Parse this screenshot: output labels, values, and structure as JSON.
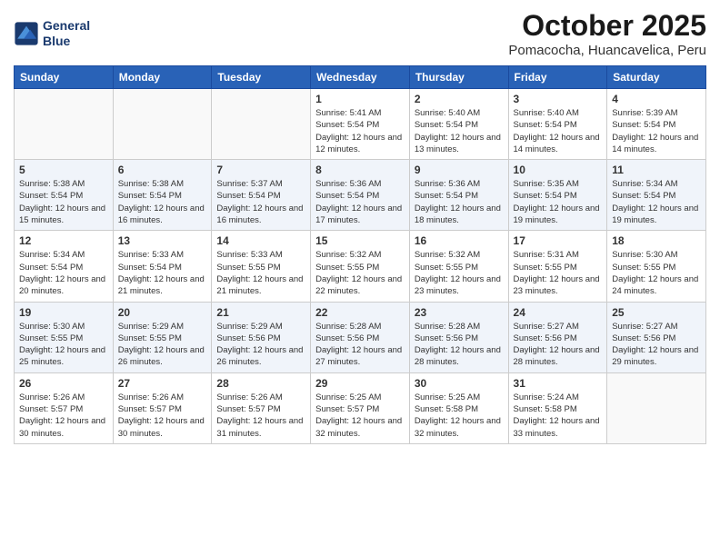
{
  "header": {
    "logo_line1": "General",
    "logo_line2": "Blue",
    "month": "October 2025",
    "location": "Pomacocha, Huancavelica, Peru"
  },
  "days_of_week": [
    "Sunday",
    "Monday",
    "Tuesday",
    "Wednesday",
    "Thursday",
    "Friday",
    "Saturday"
  ],
  "weeks": [
    {
      "shaded": false,
      "days": [
        {
          "num": "",
          "info": ""
        },
        {
          "num": "",
          "info": ""
        },
        {
          "num": "",
          "info": ""
        },
        {
          "num": "1",
          "info": "Sunrise: 5:41 AM\nSunset: 5:54 PM\nDaylight: 12 hours\nand 12 minutes."
        },
        {
          "num": "2",
          "info": "Sunrise: 5:40 AM\nSunset: 5:54 PM\nDaylight: 12 hours\nand 13 minutes."
        },
        {
          "num": "3",
          "info": "Sunrise: 5:40 AM\nSunset: 5:54 PM\nDaylight: 12 hours\nand 14 minutes."
        },
        {
          "num": "4",
          "info": "Sunrise: 5:39 AM\nSunset: 5:54 PM\nDaylight: 12 hours\nand 14 minutes."
        }
      ]
    },
    {
      "shaded": true,
      "days": [
        {
          "num": "5",
          "info": "Sunrise: 5:38 AM\nSunset: 5:54 PM\nDaylight: 12 hours\nand 15 minutes."
        },
        {
          "num": "6",
          "info": "Sunrise: 5:38 AM\nSunset: 5:54 PM\nDaylight: 12 hours\nand 16 minutes."
        },
        {
          "num": "7",
          "info": "Sunrise: 5:37 AM\nSunset: 5:54 PM\nDaylight: 12 hours\nand 16 minutes."
        },
        {
          "num": "8",
          "info": "Sunrise: 5:36 AM\nSunset: 5:54 PM\nDaylight: 12 hours\nand 17 minutes."
        },
        {
          "num": "9",
          "info": "Sunrise: 5:36 AM\nSunset: 5:54 PM\nDaylight: 12 hours\nand 18 minutes."
        },
        {
          "num": "10",
          "info": "Sunrise: 5:35 AM\nSunset: 5:54 PM\nDaylight: 12 hours\nand 19 minutes."
        },
        {
          "num": "11",
          "info": "Sunrise: 5:34 AM\nSunset: 5:54 PM\nDaylight: 12 hours\nand 19 minutes."
        }
      ]
    },
    {
      "shaded": false,
      "days": [
        {
          "num": "12",
          "info": "Sunrise: 5:34 AM\nSunset: 5:54 PM\nDaylight: 12 hours\nand 20 minutes."
        },
        {
          "num": "13",
          "info": "Sunrise: 5:33 AM\nSunset: 5:54 PM\nDaylight: 12 hours\nand 21 minutes."
        },
        {
          "num": "14",
          "info": "Sunrise: 5:33 AM\nSunset: 5:55 PM\nDaylight: 12 hours\nand 21 minutes."
        },
        {
          "num": "15",
          "info": "Sunrise: 5:32 AM\nSunset: 5:55 PM\nDaylight: 12 hours\nand 22 minutes."
        },
        {
          "num": "16",
          "info": "Sunrise: 5:32 AM\nSunset: 5:55 PM\nDaylight: 12 hours\nand 23 minutes."
        },
        {
          "num": "17",
          "info": "Sunrise: 5:31 AM\nSunset: 5:55 PM\nDaylight: 12 hours\nand 23 minutes."
        },
        {
          "num": "18",
          "info": "Sunrise: 5:30 AM\nSunset: 5:55 PM\nDaylight: 12 hours\nand 24 minutes."
        }
      ]
    },
    {
      "shaded": true,
      "days": [
        {
          "num": "19",
          "info": "Sunrise: 5:30 AM\nSunset: 5:55 PM\nDaylight: 12 hours\nand 25 minutes."
        },
        {
          "num": "20",
          "info": "Sunrise: 5:29 AM\nSunset: 5:55 PM\nDaylight: 12 hours\nand 26 minutes."
        },
        {
          "num": "21",
          "info": "Sunrise: 5:29 AM\nSunset: 5:56 PM\nDaylight: 12 hours\nand 26 minutes."
        },
        {
          "num": "22",
          "info": "Sunrise: 5:28 AM\nSunset: 5:56 PM\nDaylight: 12 hours\nand 27 minutes."
        },
        {
          "num": "23",
          "info": "Sunrise: 5:28 AM\nSunset: 5:56 PM\nDaylight: 12 hours\nand 28 minutes."
        },
        {
          "num": "24",
          "info": "Sunrise: 5:27 AM\nSunset: 5:56 PM\nDaylight: 12 hours\nand 28 minutes."
        },
        {
          "num": "25",
          "info": "Sunrise: 5:27 AM\nSunset: 5:56 PM\nDaylight: 12 hours\nand 29 minutes."
        }
      ]
    },
    {
      "shaded": false,
      "days": [
        {
          "num": "26",
          "info": "Sunrise: 5:26 AM\nSunset: 5:57 PM\nDaylight: 12 hours\nand 30 minutes."
        },
        {
          "num": "27",
          "info": "Sunrise: 5:26 AM\nSunset: 5:57 PM\nDaylight: 12 hours\nand 30 minutes."
        },
        {
          "num": "28",
          "info": "Sunrise: 5:26 AM\nSunset: 5:57 PM\nDaylight: 12 hours\nand 31 minutes."
        },
        {
          "num": "29",
          "info": "Sunrise: 5:25 AM\nSunset: 5:57 PM\nDaylight: 12 hours\nand 32 minutes."
        },
        {
          "num": "30",
          "info": "Sunrise: 5:25 AM\nSunset: 5:58 PM\nDaylight: 12 hours\nand 32 minutes."
        },
        {
          "num": "31",
          "info": "Sunrise: 5:24 AM\nSunset: 5:58 PM\nDaylight: 12 hours\nand 33 minutes."
        },
        {
          "num": "",
          "info": ""
        }
      ]
    }
  ]
}
